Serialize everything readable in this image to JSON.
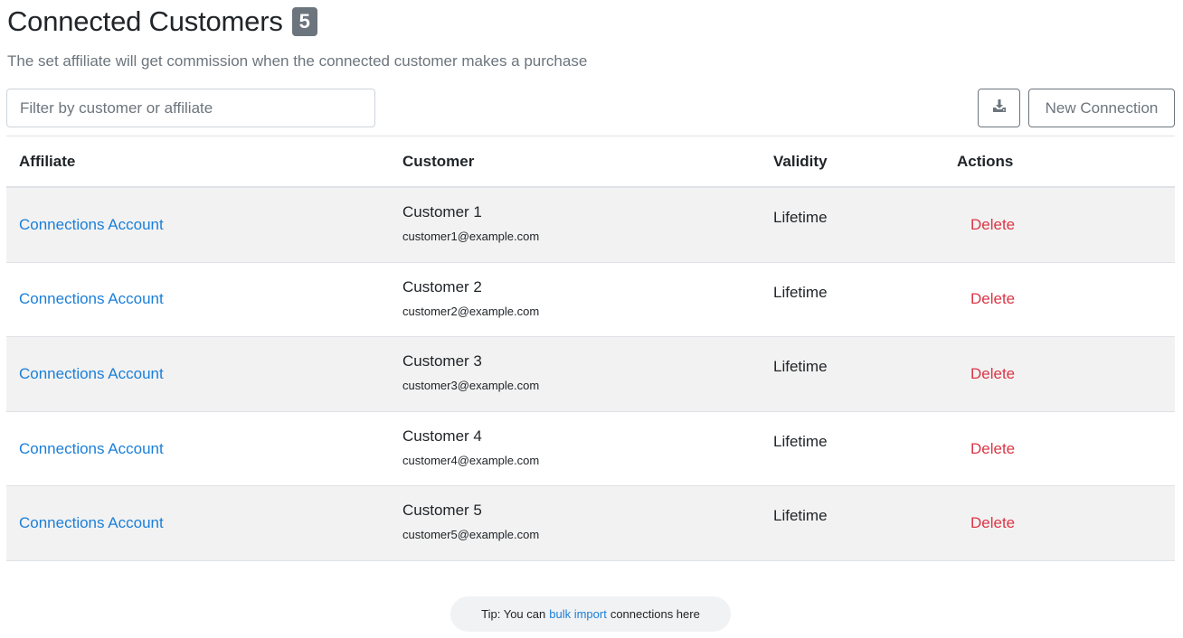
{
  "header": {
    "title": "Connected Customers",
    "count": "5",
    "subtitle": "The set affiliate will get commission when the connected customer makes a purchase"
  },
  "toolbar": {
    "filter_placeholder": "Filter by customer or affiliate",
    "download_icon": "download-icon",
    "new_connection_label": "New Connection"
  },
  "table": {
    "columns": [
      "Affiliate",
      "Customer",
      "Validity",
      "Actions"
    ],
    "rows": [
      {
        "affiliate": "Connections Account",
        "customer_name": "Customer 1",
        "customer_email": "customer1@example.com",
        "validity": "Lifetime",
        "action": "Delete"
      },
      {
        "affiliate": "Connections Account",
        "customer_name": "Customer 2",
        "customer_email": "customer2@example.com",
        "validity": "Lifetime",
        "action": "Delete"
      },
      {
        "affiliate": "Connections Account",
        "customer_name": "Customer 3",
        "customer_email": "customer3@example.com",
        "validity": "Lifetime",
        "action": "Delete"
      },
      {
        "affiliate": "Connections Account",
        "customer_name": "Customer 4",
        "customer_email": "customer4@example.com",
        "validity": "Lifetime",
        "action": "Delete"
      },
      {
        "affiliate": "Connections Account",
        "customer_name": "Customer 5",
        "customer_email": "customer5@example.com",
        "validity": "Lifetime",
        "action": "Delete"
      }
    ]
  },
  "tip": {
    "prefix": "Tip: You can",
    "link": "bulk import",
    "suffix": "connections here"
  },
  "colors": {
    "link": "#1a7fd9",
    "danger": "#dc3545",
    "badge": "#6c757d",
    "row_stripe": "#f2f2f2"
  }
}
